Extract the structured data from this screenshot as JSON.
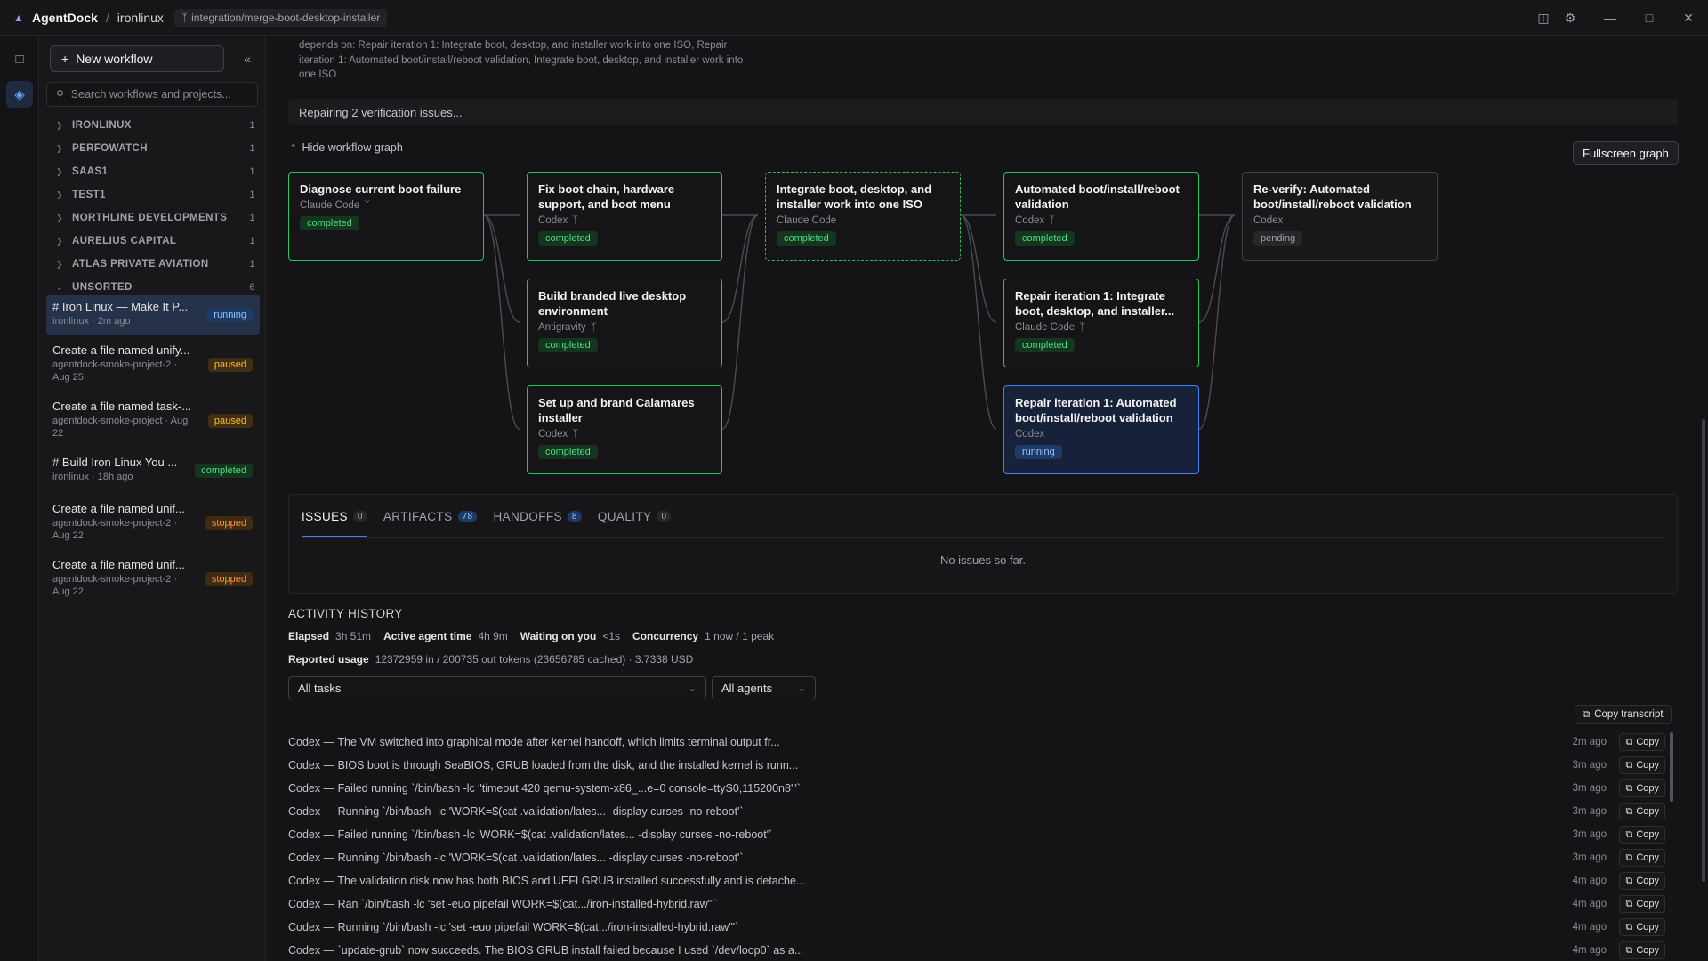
{
  "titlebar": {
    "app": "AgentDock",
    "separator": "/",
    "project": "ironlinux",
    "branch": "integration/merge-boot-desktop-installer"
  },
  "sidebar": {
    "new_workflow": "New workflow",
    "search_placeholder": "Search workflows and projects...",
    "groups": [
      {
        "name": "IRONLINUX",
        "count": "1"
      },
      {
        "name": "PERFOWATCH",
        "count": "1"
      },
      {
        "name": "SAAS1",
        "count": "1"
      },
      {
        "name": "TEST1",
        "count": "1"
      },
      {
        "name": "NORTHLINE DEVELOPMENTS",
        "count": "1"
      },
      {
        "name": "AURELIUS CAPITAL",
        "count": "1"
      },
      {
        "name": "ATLAS PRIVATE AVIATION",
        "count": "1"
      },
      {
        "name": "UNSORTED",
        "count": "6"
      }
    ],
    "workflows": [
      {
        "title": "# Iron Linux — Make It P...",
        "sub": "ironlinux · 2m ago",
        "status": "running"
      },
      {
        "title": "Create a file named unify...",
        "sub": "agentdock-smoke-project-2 · Aug 25",
        "status": "paused"
      },
      {
        "title": "Create a file named task-...",
        "sub": "agentdock-smoke-project · Aug 22",
        "status": "paused"
      },
      {
        "title": "# Build Iron Linux You ...",
        "sub": "ironlinux · 18h ago",
        "status": "completed"
      },
      {
        "title": "Create a file named unif...",
        "sub": "agentdock-smoke-project-2 · Aug 22",
        "status": "stopped"
      },
      {
        "title": "Create a file named unif...",
        "sub": "agentdock-smoke-project-2 · Aug 22",
        "status": "stopped"
      }
    ]
  },
  "main": {
    "depends": "depends on: Repair iteration 1: Integrate boot, desktop, and installer work into one ISO, Repair iteration 1: Automated boot/install/reboot validation, Integrate boot, desktop, and installer work into one ISO",
    "repair_status": "Repairing 2 verification issues...",
    "hide_graph": "Hide workflow graph",
    "fullscreen": "Fullscreen graph",
    "nodes": [
      {
        "title": "Diagnose current boot failure",
        "agent": "Claude Code",
        "status": "completed"
      },
      {
        "title": "Fix boot chain, hardware support, and boot menu",
        "agent": "Codex",
        "status": "completed"
      },
      {
        "title": "Build branded live desktop environment",
        "agent": "Antigravity",
        "status": "completed"
      },
      {
        "title": "Set up and brand Calamares installer",
        "agent": "Codex",
        "status": "completed"
      },
      {
        "title": "Integrate boot, desktop, and installer work into one ISO",
        "agent": "Claude Code",
        "status": "completed"
      },
      {
        "title": "Automated boot/install/reboot validation",
        "agent": "Codex",
        "status": "completed"
      },
      {
        "title": "Repair iteration 1: Integrate boot, desktop, and installer...",
        "agent": "Claude Code",
        "status": "completed"
      },
      {
        "title": "Repair iteration 1: Automated boot/install/reboot validation",
        "agent": "Codex",
        "status": "running"
      },
      {
        "title": "Re-verify: Automated boot/install/reboot validation",
        "agent": "Codex",
        "status": "pending"
      }
    ],
    "tabs": [
      {
        "label": "ISSUES",
        "count": "0"
      },
      {
        "label": "ARTIFACTS",
        "count": "78"
      },
      {
        "label": "HANDOFFS",
        "count": "8"
      },
      {
        "label": "QUALITY",
        "count": "0"
      }
    ],
    "no_issues": "No issues so far.",
    "activity": {
      "title": "ACTIVITY HISTORY",
      "elapsed_label": "Elapsed",
      "elapsed": "3h 51m",
      "agent_time_label": "Active agent time",
      "agent_time": "4h 9m",
      "waiting_label": "Waiting on you",
      "waiting": "<1s",
      "concurrency_label": "Concurrency",
      "concurrency": "1 now / 1 peak",
      "usage_label": "Reported usage",
      "usage": "12372959 in / 200735 out tokens (23656785 cached) · 3.7338 USD",
      "task_filter": "All tasks",
      "agent_filter": "All agents",
      "copy_transcript": "Copy transcript",
      "copy_label": "Copy",
      "log": [
        {
          "text": "Codex — The VM switched into graphical mode after kernel handoff, which limits terminal output fr...",
          "time": "2m ago"
        },
        {
          "text": "Codex — BIOS boot is through SeaBIOS, GRUB loaded from the disk, and the installed kernel is runn...",
          "time": "3m ago"
        },
        {
          "text": "Codex — Failed running `/bin/bash -lc \"timeout 420 qemu-system-x86_...e=0 console=ttyS0,115200n8'\"`",
          "time": "3m ago"
        },
        {
          "text": "Codex — Running `/bin/bash -lc 'WORK=$(cat .validation/lates... -display curses -no-reboot'`",
          "time": "3m ago"
        },
        {
          "text": "Codex — Failed running `/bin/bash -lc 'WORK=$(cat .validation/lates... -display curses -no-reboot'`",
          "time": "3m ago"
        },
        {
          "text": "Codex — Running `/bin/bash -lc 'WORK=$(cat .validation/lates... -display curses -no-reboot'`",
          "time": "3m ago"
        },
        {
          "text": "Codex — The validation disk now has both BIOS and UEFI GRUB installed successfully and is detache...",
          "time": "4m ago"
        },
        {
          "text": "Codex — Ran `/bin/bash -lc 'set -euo pipefail WORK=$(cat.../iron-installed-hybrid.raw\"'`",
          "time": "4m ago"
        },
        {
          "text": "Codex — Running `/bin/bash -lc 'set -euo pipefail WORK=$(cat.../iron-installed-hybrid.raw\"'`",
          "time": "4m ago"
        },
        {
          "text": "Codex — `update-grub` now succeeds. The BIOS GRUB install failed because I used `/dev/loop0` as a...",
          "time": "4m ago"
        }
      ]
    }
  }
}
